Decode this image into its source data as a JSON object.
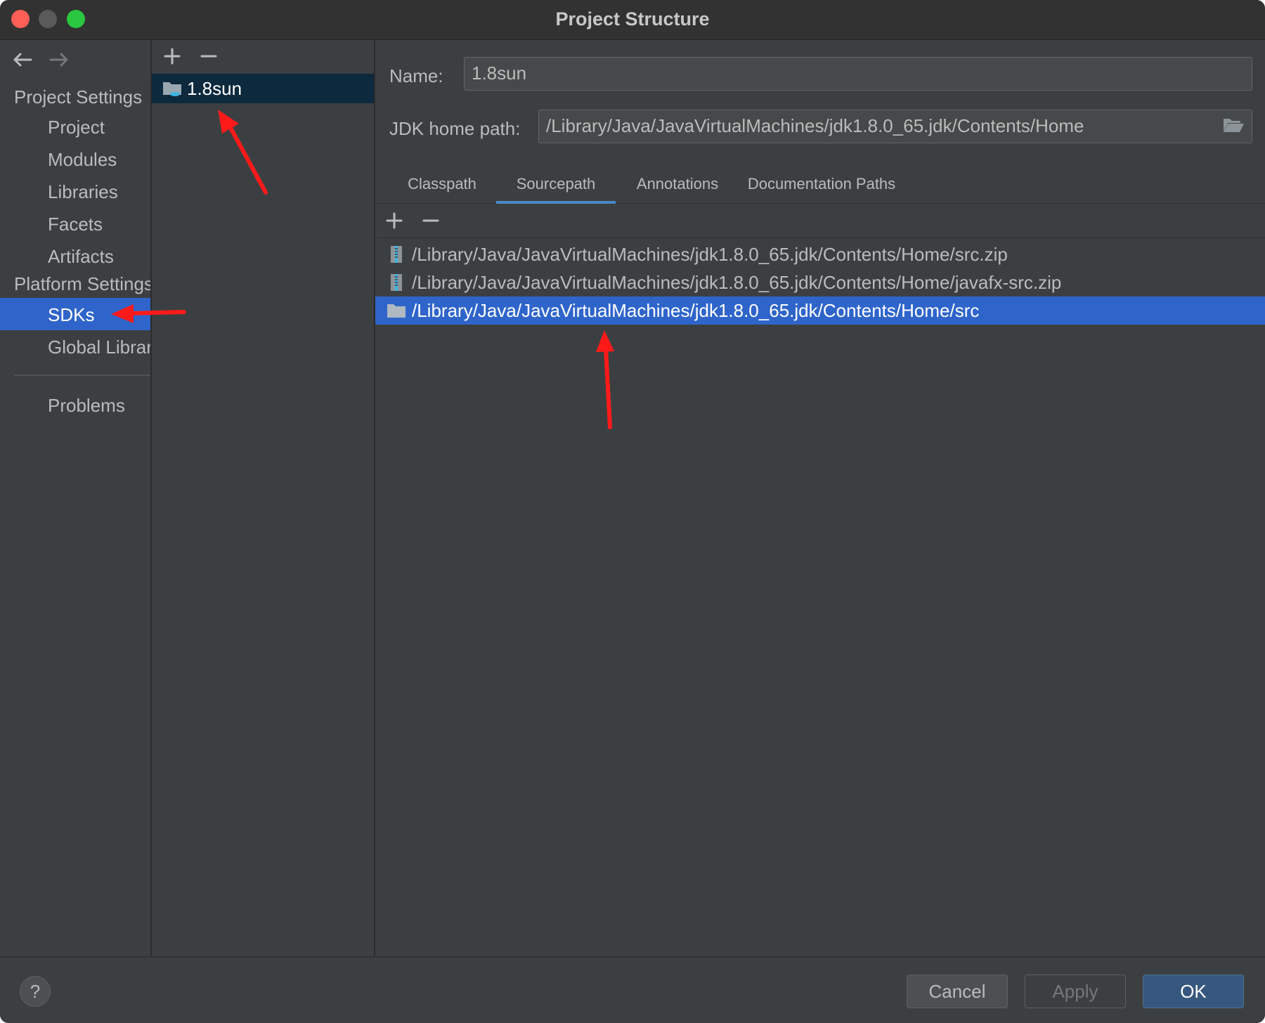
{
  "window": {
    "title": "Project Structure"
  },
  "nav": {
    "project_settings_header": "Project Settings",
    "project_items": [
      "Project",
      "Modules",
      "Libraries",
      "Facets",
      "Artifacts"
    ],
    "platform_settings_header": "Platform Settings",
    "platform_items": [
      "SDKs",
      "Global Libraries"
    ],
    "problems": "Problems",
    "selected": "SDKs"
  },
  "sdk_list": {
    "items": [
      "1.8sun"
    ],
    "selected": "1.8sun"
  },
  "detail": {
    "name_label": "Name:",
    "name_value": "1.8sun",
    "jdk_home_label": "JDK home path:",
    "jdk_home_value": "/Library/Java/JavaVirtualMachines/jdk1.8.0_65.jdk/Contents/Home",
    "tabs": [
      "Classpath",
      "Sourcepath",
      "Annotations",
      "Documentation Paths"
    ],
    "active_tab": "Sourcepath",
    "paths": [
      {
        "text": "/Library/Java/JavaVirtualMachines/jdk1.8.0_65.jdk/Contents/Home/src.zip",
        "icon": "archive-icon"
      },
      {
        "text": "/Library/Java/JavaVirtualMachines/jdk1.8.0_65.jdk/Contents/Home/javafx-src.zip",
        "icon": "archive-icon"
      },
      {
        "text": "/Library/Java/JavaVirtualMachines/jdk1.8.0_65.jdk/Contents/Home/src",
        "icon": "folder-icon"
      }
    ],
    "selected_path_index": 2
  },
  "footer": {
    "help": "?",
    "cancel": "Cancel",
    "apply": "Apply",
    "ok": "OK"
  },
  "colors": {
    "selection": "#2f65ca",
    "sdk_selection": "#0d293e",
    "annotation_arrow": "#ff1a1a"
  }
}
